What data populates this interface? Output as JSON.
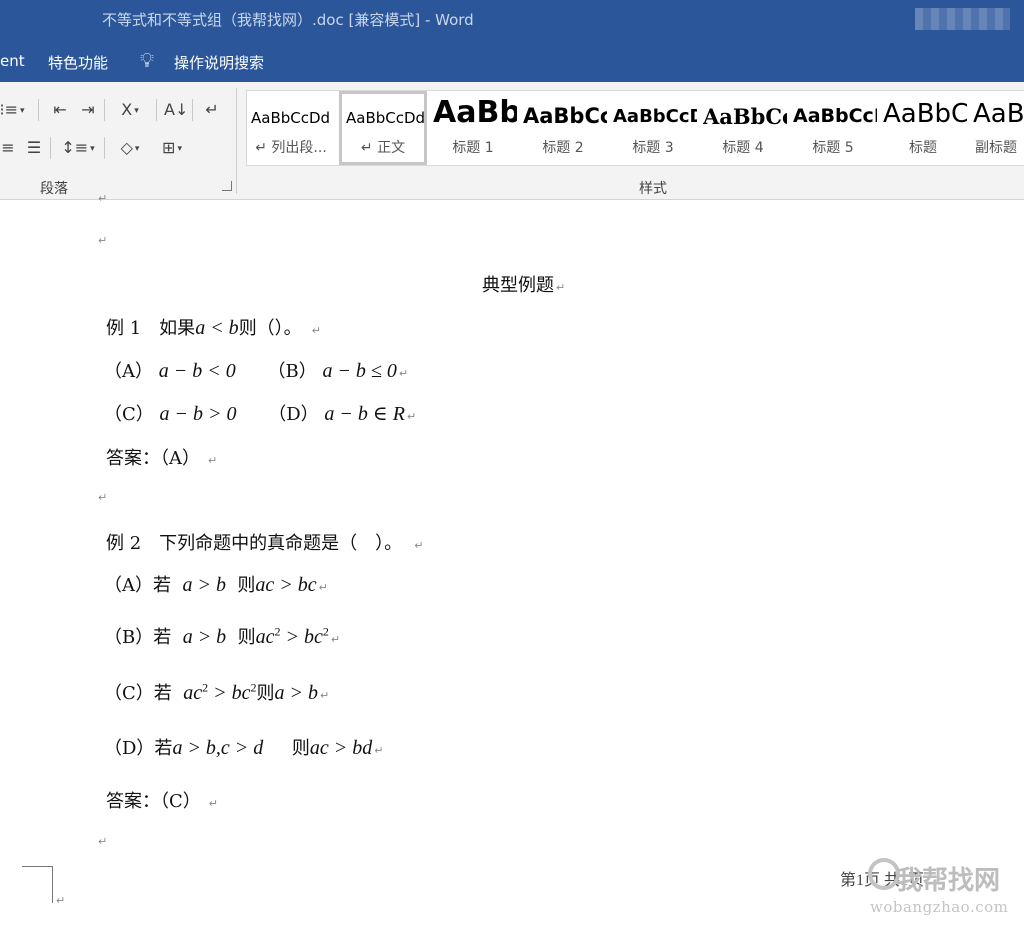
{
  "window": {
    "title": "不等式和不等式组（我帮找网）.doc [兼容模式]  -  Word"
  },
  "menu": {
    "items": [
      "ent",
      "特色功能",
      "操作说明搜索"
    ]
  },
  "ribbon": {
    "groups": {
      "paragraph": "段落",
      "styles": "样式"
    },
    "styles": [
      {
        "preview": "AaBbCcDd",
        "name": "↵ 列出段..."
      },
      {
        "preview": "AaBbCcDd",
        "name": "↵ 正文"
      },
      {
        "preview": "AaBb",
        "name": "标题 1"
      },
      {
        "preview": "AaBbCc",
        "name": "标题 2"
      },
      {
        "preview": "AaBbCcD",
        "name": "标题 3"
      },
      {
        "preview": "AaBbCc",
        "name": "标题 4"
      },
      {
        "preview": "AaBbCcI",
        "name": "标题 5"
      },
      {
        "preview": "AaBbC",
        "name": "标题"
      },
      {
        "preview": "AaBb",
        "name": "副标题"
      }
    ]
  },
  "document": {
    "heading": "典型例题",
    "ex1": {
      "q_label": "例 1　如果",
      "q_math": "a < b",
      "q_end": "则（）。",
      "A_label": "（A）",
      "A_math": "a − b < 0",
      "B_label": "（B）",
      "B_math": "a − b ≤ 0",
      "C_label": "（C）",
      "C_math": "a − b > 0",
      "D_label": "（D）",
      "D_math": "a − b ∈ R",
      "answer": "答案：（A）"
    },
    "ex2": {
      "q": "例 2　下列命题中的真命题是（　）。",
      "A_label": "（A）若",
      "A_m1": "a > b",
      "A_mid": "则",
      "A_m2": "ac > bc",
      "B_label": "（B）若",
      "B_m1": "a > b",
      "B_mid": "则",
      "B_m2a": "ac",
      "B_sup1": "2",
      "B_m2b": " > bc",
      "B_sup2": "2",
      "C_label": "（C）若",
      "C_m1a": "ac",
      "C_sup1": "2",
      "C_m1b": " > bc",
      "C_sup2": "2",
      "C_mid": "则",
      "C_m2": "a > b",
      "D_label": "（D）若",
      "D_m1": "a > b,c > d",
      "D_mid": "则",
      "D_m2": "ac > bd",
      "answer": "答案：（C）"
    },
    "para_mark": "↵",
    "footer": "第1页 共1页"
  },
  "watermark": {
    "text": "我帮找网",
    "url": "wobangzhao.com"
  }
}
